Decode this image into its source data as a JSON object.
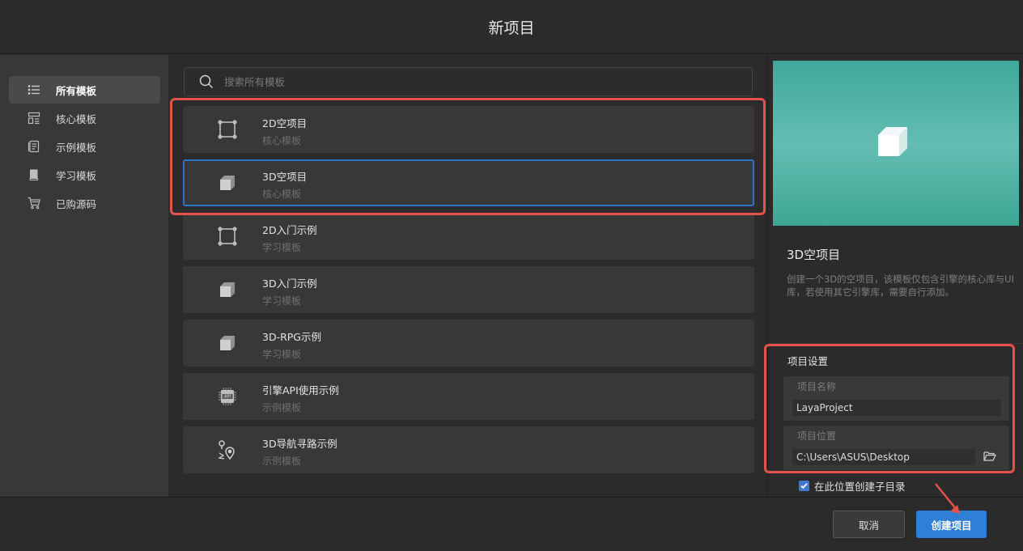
{
  "window": {
    "title": "新项目"
  },
  "sidebar": {
    "items": [
      {
        "label": "所有模板",
        "icon": "list-icon",
        "active": true
      },
      {
        "label": "核心模板",
        "icon": "core-template-icon",
        "active": false
      },
      {
        "label": "示例模板",
        "icon": "document-icon",
        "active": false
      },
      {
        "label": "学习模板",
        "icon": "book-icon",
        "active": false
      },
      {
        "label": "已购源码",
        "icon": "cart-icon",
        "active": false
      }
    ]
  },
  "search": {
    "placeholder": "搜索所有模板"
  },
  "templates": [
    {
      "name": "2D空项目",
      "category": "核心模板",
      "icon": "2d-square-icon",
      "selected": false
    },
    {
      "name": "3D空项目",
      "category": "核心模板",
      "icon": "3d-cube-icon",
      "selected": true
    },
    {
      "name": "2D入门示例",
      "category": "学习模板",
      "icon": "2d-square-icon",
      "selected": false
    },
    {
      "name": "3D入门示例",
      "category": "学习模板",
      "icon": "3d-cube-icon",
      "selected": false
    },
    {
      "name": "3D-RPG示例",
      "category": "学习模板",
      "icon": "3d-cube-icon",
      "selected": false
    },
    {
      "name": "引擎API使用示例",
      "category": "示例模板",
      "icon": "api-chip-icon",
      "selected": false
    },
    {
      "name": "3D导航寻路示例",
      "category": "示例模板",
      "icon": "navigation-pin-icon",
      "selected": false
    }
  ],
  "detail": {
    "title": "3D空项目",
    "description": "创建一个3D的空项目，该模板仅包含引擎的核心库与UI库，若使用其它引擎库，需要自行添加。"
  },
  "settings": {
    "title": "项目设置",
    "name_label": "项目名称",
    "name_value": "LayaProject",
    "location_label": "项目位置",
    "location_value": "C:\\Users\\ASUS\\Desktop",
    "create_subdir_label": "在此位置创建子目录",
    "create_subdir_checked": true
  },
  "footer": {
    "cancel_label": "取消",
    "create_label": "创建项目"
  },
  "colors": {
    "accent": "#2f7fd6",
    "selected_border": "#2f73c6",
    "highlight": "#e5524a",
    "preview_bg": "#4fb3a6"
  }
}
